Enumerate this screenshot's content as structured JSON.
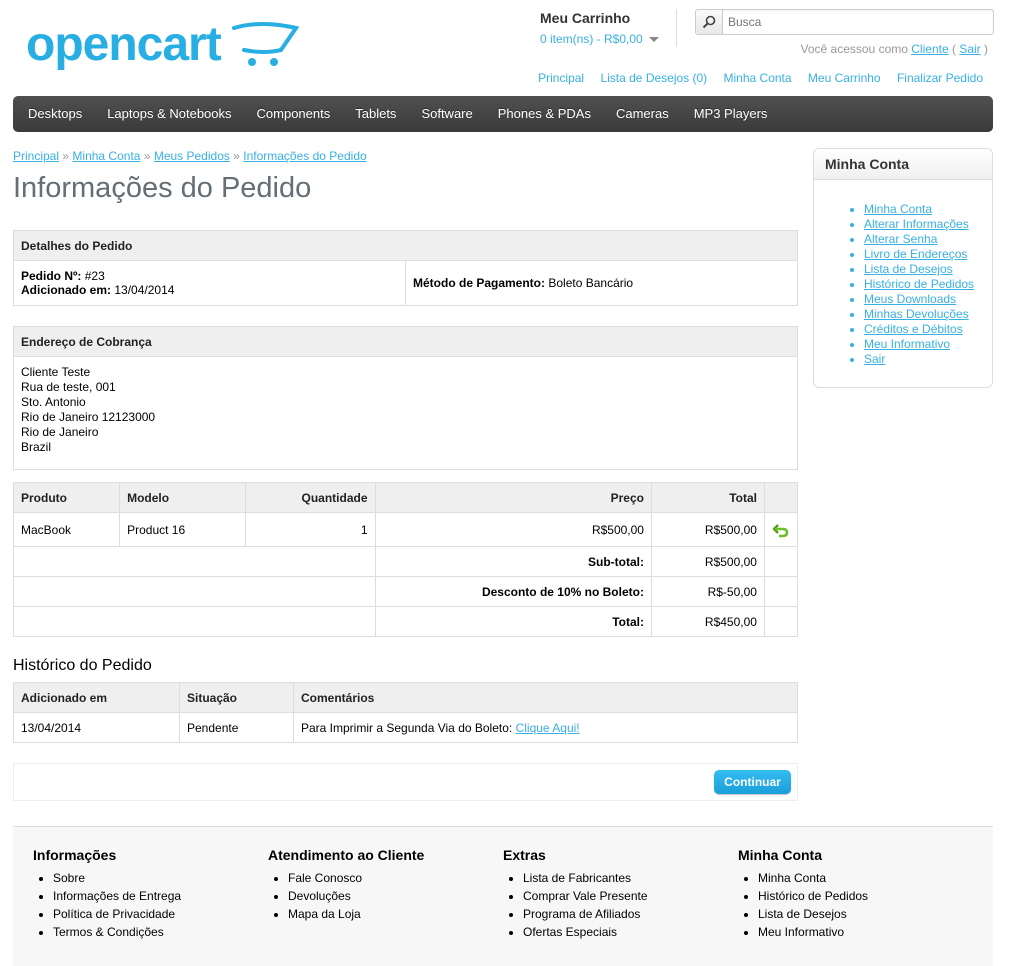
{
  "header": {
    "logo_text": "opencart",
    "cart": {
      "heading": "Meu Carrinho",
      "summary": "0 item(ns) - R$0,00"
    },
    "search": {
      "placeholder": "Busca"
    },
    "welcome": {
      "prefix": "Você acessou como",
      "user": "Cliente",
      "open": "(",
      "logout": "Sair",
      "close": ")"
    },
    "links": [
      "Principal",
      "Lista de Desejos (0)",
      "Minha Conta",
      "Meu Carrinho",
      "Finalizar Pedido"
    ]
  },
  "menu": [
    "Desktops",
    "Laptops & Notebooks",
    "Components",
    "Tablets",
    "Software",
    "Phones & PDAs",
    "Cameras",
    "MP3 Players"
  ],
  "breadcrumb": {
    "items": [
      "Principal",
      "Minha Conta",
      "Meus Pedidos",
      "Informações do Pedido"
    ],
    "separator": "»"
  },
  "page_title": "Informações do Pedido",
  "order_details": {
    "heading": "Detalhes do Pedido",
    "order_no_label": "Pedido Nº:",
    "order_no": "#23",
    "added_label": "Adicionado em:",
    "added": "13/04/2014",
    "payment_label": "Método de Pagamento:",
    "payment": "Boleto Bancário"
  },
  "billing": {
    "heading": "Endereço de Cobrança",
    "lines": [
      "Cliente Teste",
      "Rua de teste, 001",
      "Sto. Antonio",
      "Rio de Janeiro 12123000",
      "Rio de Janeiro",
      "Brazil"
    ]
  },
  "products": {
    "columns": [
      "Produto",
      "Modelo",
      "Quantidade",
      "Preço",
      "Total"
    ],
    "rows": [
      {
        "product": "MacBook",
        "model": "Product 16",
        "qty": "1",
        "price": "R$500,00",
        "total": "R$500,00"
      }
    ],
    "totals": [
      {
        "label": "Sub-total:",
        "value": "R$500,00"
      },
      {
        "label": "Desconto de 10% no Boleto:",
        "value": "R$-50,00"
      },
      {
        "label": "Total:",
        "value": "R$450,00"
      }
    ]
  },
  "history": {
    "title": "Histórico do Pedido",
    "columns": [
      "Adicionado em",
      "Situação",
      "Comentários"
    ],
    "rows": [
      {
        "date": "13/04/2014",
        "status": "Pendente",
        "comment": "Para Imprimir a Segunda Via do Boleto:",
        "link": "Clique Aqui!"
      }
    ]
  },
  "continue_button": "Continuar",
  "sidebar": {
    "heading": "Minha Conta",
    "items": [
      "Minha Conta",
      "Alterar Informações",
      "Alterar Senha",
      "Livro de Endereços",
      "Lista de Desejos",
      "Histórico de Pedidos",
      "Meus Downloads",
      "Minhas Devoluções",
      "Créditos e Débitos",
      "Meu Informativo",
      "Sair"
    ]
  },
  "footer": {
    "columns": [
      {
        "title": "Informações",
        "items": [
          "Sobre",
          "Informações de Entrega",
          "Política de Privacidade",
          "Termos & Condições"
        ]
      },
      {
        "title": "Atendimento ao Cliente",
        "items": [
          "Fale Conosco",
          "Devoluções",
          "Mapa da Loja"
        ]
      },
      {
        "title": "Extras",
        "items": [
          "Lista de Fabricantes",
          "Comprar Vale Presente",
          "Programa de Afiliados",
          "Ofertas Especiais"
        ]
      },
      {
        "title": "Minha Conta",
        "items": [
          "Minha Conta",
          "Histórico de Pedidos",
          "Lista de Desejos",
          "Meu Informativo"
        ]
      }
    ]
  },
  "colors": {
    "link": "#38b0e3",
    "menu_bg": "#3f3f3f",
    "title": "#636e75",
    "button": "#1ea9e1"
  }
}
